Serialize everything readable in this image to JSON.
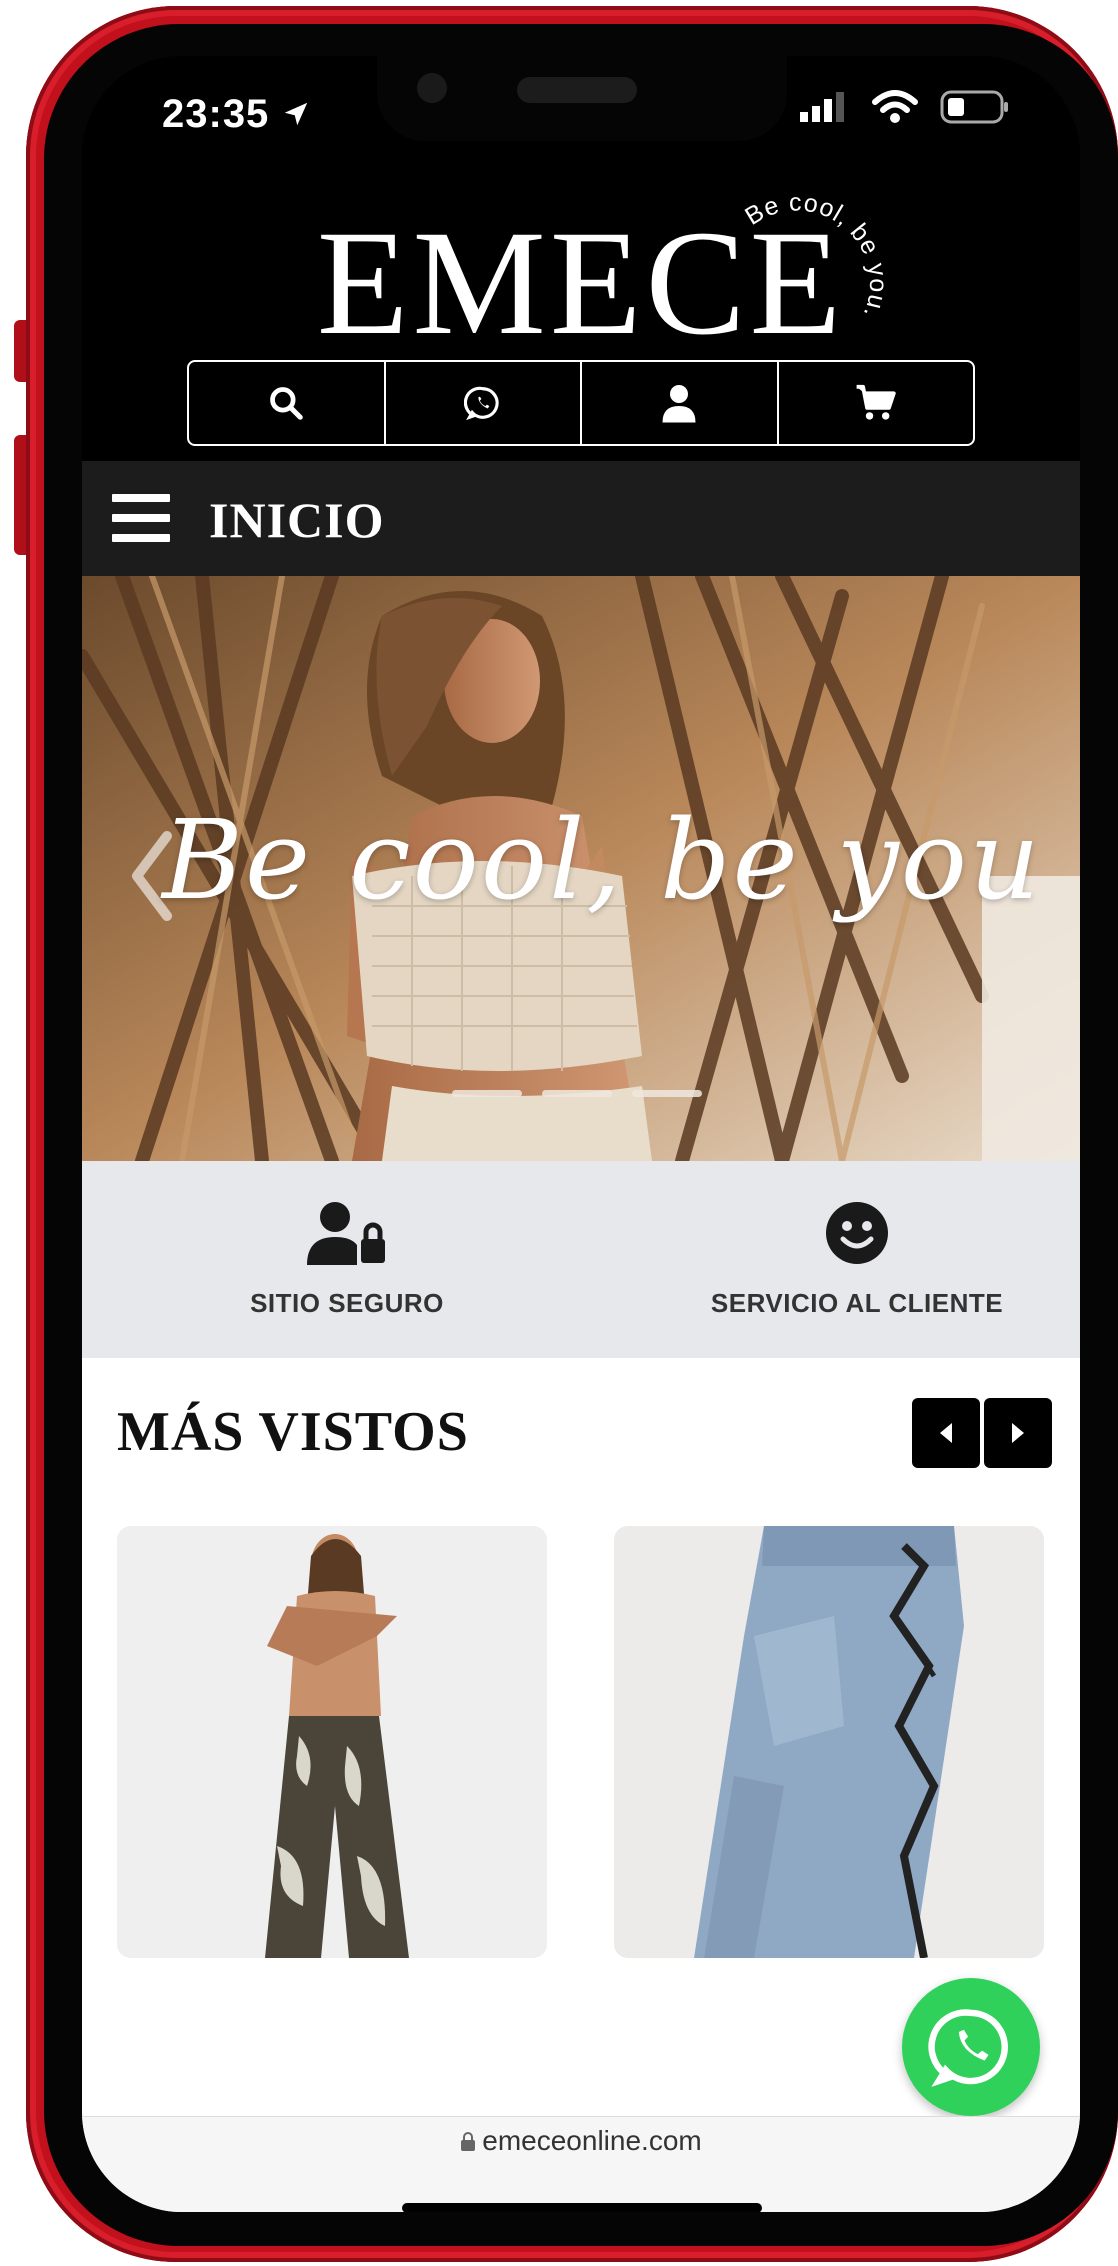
{
  "status_bar": {
    "time": "23:35"
  },
  "header": {
    "logo": "EMECE",
    "tagline": "Be cool, be you."
  },
  "header_icons": [
    "search-icon",
    "whatsapp-icon",
    "user-icon",
    "cart-icon"
  ],
  "nav": {
    "label": "INICIO"
  },
  "hero": {
    "headline": "Be cool, be you"
  },
  "trust": {
    "secure_site": "SITIO SEGURO",
    "customer_service": "SERVICIO AL CLIENTE"
  },
  "section": {
    "title": "MÁS VISTOS"
  },
  "browser": {
    "url": "emeceonline.com"
  },
  "colors": {
    "frame": "#c2101c",
    "nav_bg": "#1c1c1c",
    "trust_bg": "#e6e8eb",
    "whatsapp": "#2fd15a"
  }
}
